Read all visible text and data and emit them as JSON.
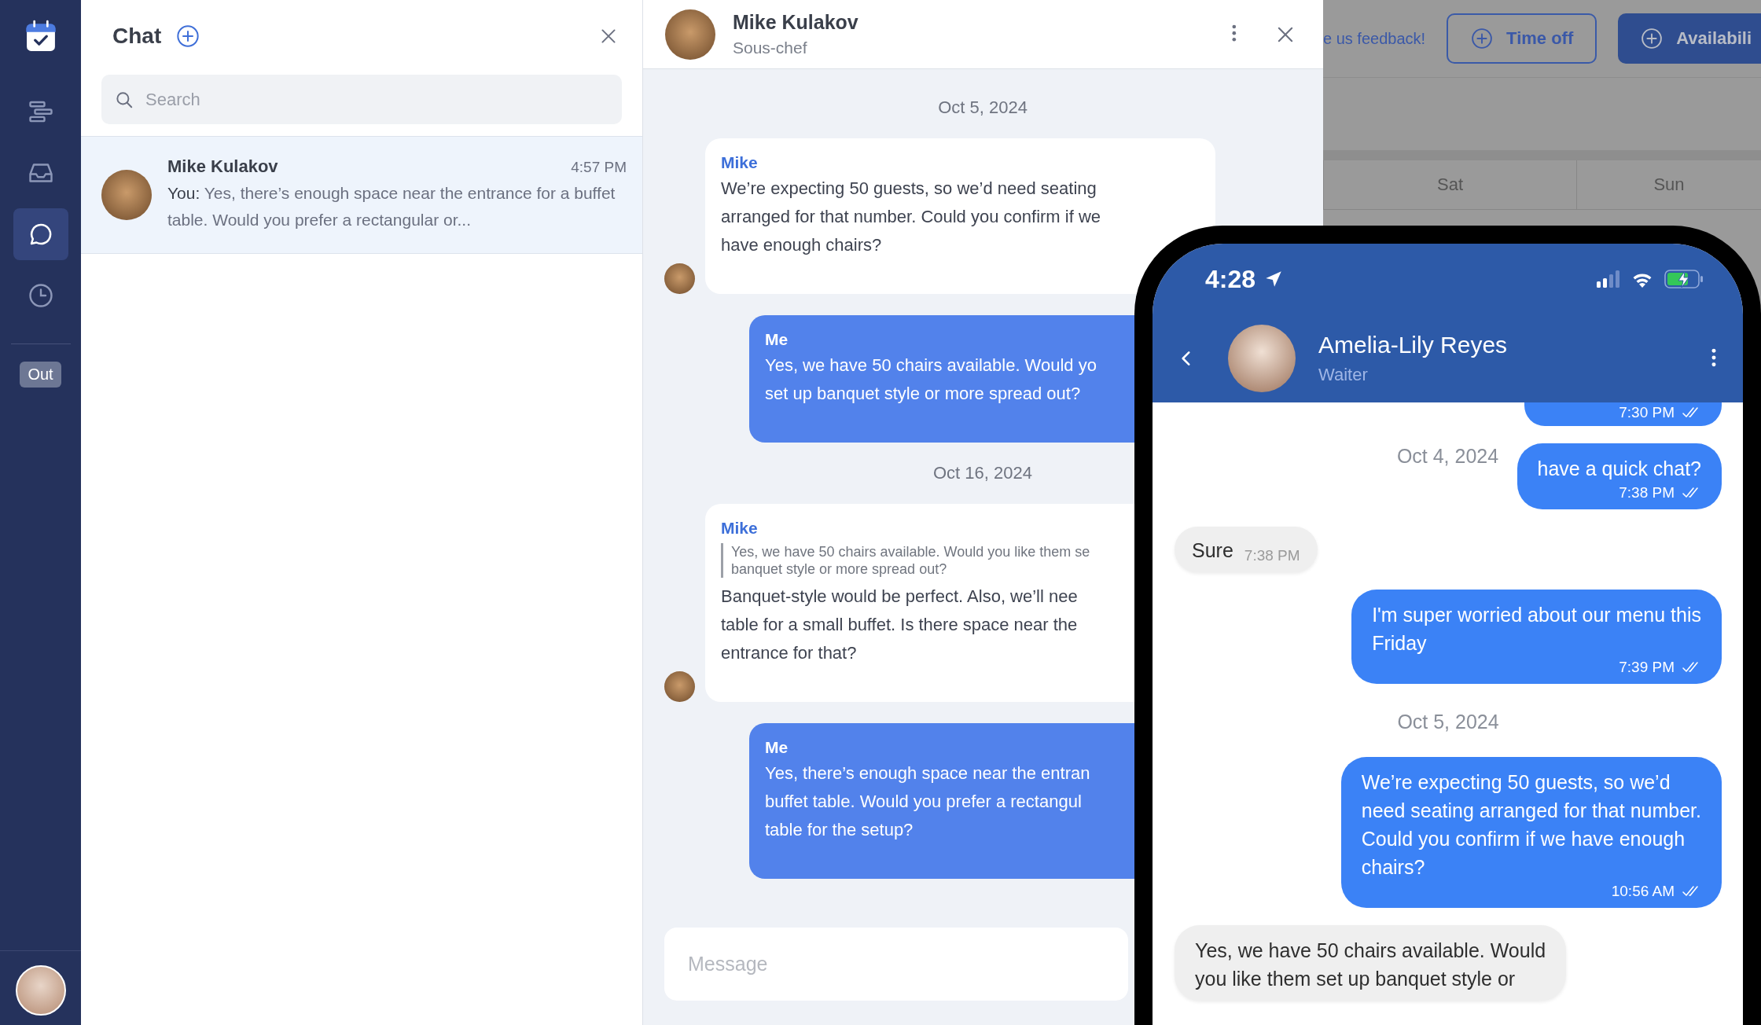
{
  "nav": {
    "items": [
      {
        "kind": "tasks",
        "selected": false
      },
      {
        "kind": "inbox",
        "selected": false
      },
      {
        "kind": "chat",
        "selected": true
      },
      {
        "kind": "clock",
        "selected": false
      }
    ],
    "status_badge": "Out"
  },
  "chat_list": {
    "title": "Chat",
    "search": {
      "placeholder": "Search"
    },
    "conversations": [
      {
        "name": "Mike Kulakov",
        "time": "4:57 PM",
        "sender": "You:",
        "preview": "Yes, there’s enough space near the entrance for a buffet table. Would you prefer a rectangular or...",
        "selected": true
      }
    ]
  },
  "conversation": {
    "name": "Mike Kulakov",
    "role": "Sous-chef",
    "messages": [
      {
        "kind": "date",
        "text": "Oct 5, 2024"
      },
      {
        "kind": "incoming",
        "sender": "Mike",
        "text": "We’re expecting 50 guests, so we’d need seating\narranged for that number. Could you confirm if we\nhave enough chairs?"
      },
      {
        "kind": "outgoing",
        "sender": "Me",
        "text": "Yes, we have 50 chairs available. Would yo\nset up banquet style or more spread out?"
      },
      {
        "kind": "date",
        "text": "Oct 16, 2024"
      },
      {
        "kind": "incoming",
        "sender": "Mike",
        "quote": "Yes, we have 50 chairs available. Would you like them se\nbanquet style or more spread out?",
        "text": "Banquet-style would be perfect. Also, we’ll nee\ntable for a small buffet. Is there space near the\nentrance for that?"
      },
      {
        "kind": "outgoing",
        "sender": "Me",
        "text": "Yes, there’s enough space near the entran\nbuffet table. Would you prefer a rectangul\ntable for the setup?"
      }
    ],
    "composer": {
      "placeholder": "Message"
    }
  },
  "background": {
    "feedback_link": "e us feedback!",
    "buttons": [
      {
        "kind": "outline",
        "label": "Time off"
      },
      {
        "kind": "filled",
        "label": "Availabili"
      }
    ],
    "calendar_columns": [
      "Sat",
      "Sun"
    ]
  },
  "phone": {
    "clock": "4:28",
    "contact": {
      "name": "Amelia-Lily Reyes",
      "role": "Waiter"
    },
    "floating_date": "Oct 4, 2024",
    "messages": [
      {
        "kind": "outgoing",
        "time": "7:30 PM",
        "read": true
      },
      {
        "kind": "outgoing",
        "text": "have a quick chat?",
        "time": "7:38 PM",
        "read": true
      },
      {
        "kind": "incoming",
        "text": "Sure",
        "time": "7:38 PM"
      },
      {
        "kind": "outgoing",
        "text": "I'm super worried about our menu this\nFriday",
        "time": "7:39 PM",
        "read": true
      },
      {
        "kind": "date",
        "text": "Oct 5, 2024"
      },
      {
        "kind": "outgoing",
        "text": "We’re expecting 50 guests, so we’d\nneed seating arranged for that number.\nCould you confirm if we have enough\nchairs?",
        "time": "10:56 AM",
        "read": true
      },
      {
        "kind": "incoming",
        "text": "Yes, we have 50 chairs available. Would\nyou like them set up banquet style or"
      }
    ]
  }
}
